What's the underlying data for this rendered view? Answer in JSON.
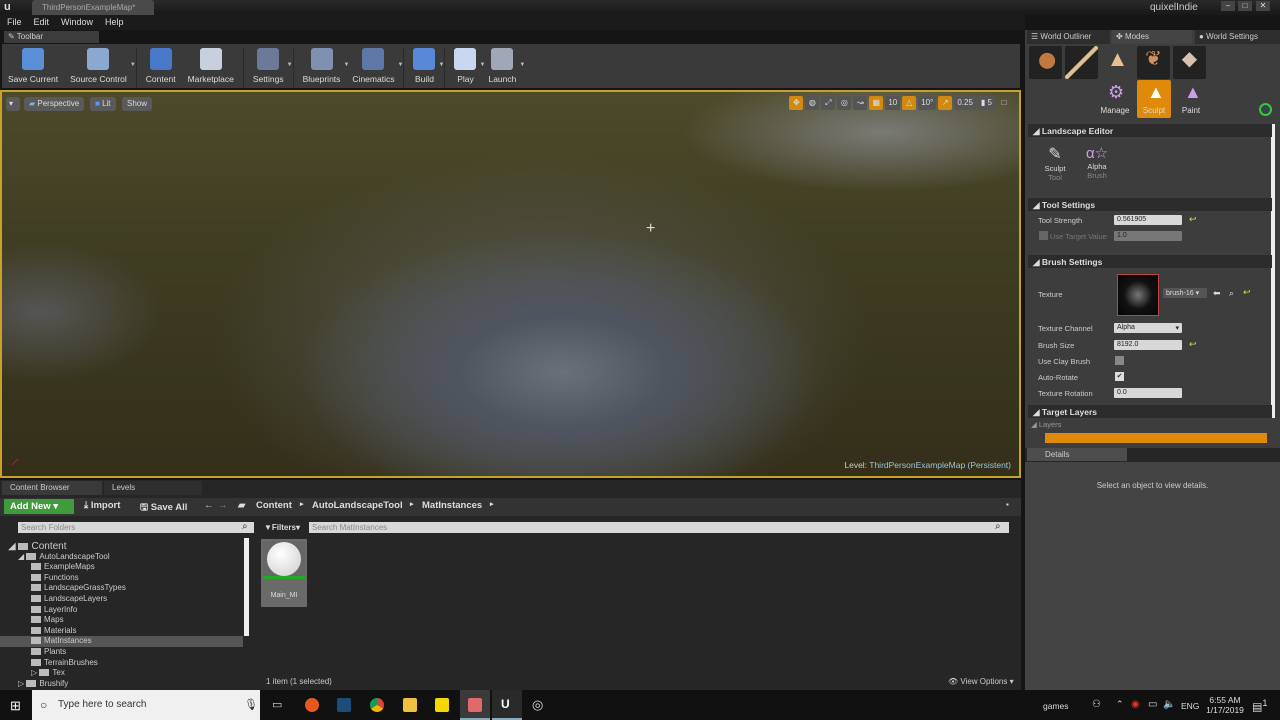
{
  "window": {
    "map_tab": "ThirdPersonExampleMap*",
    "user": "quixelIndie"
  },
  "menu": [
    "File",
    "Edit",
    "Window",
    "Help"
  ],
  "toolbar_tab": "Toolbar",
  "toolbar": [
    {
      "label": "Save Current",
      "color": "#5a8fd8",
      "dd": false
    },
    {
      "label": "Source Control",
      "color": "#8aa8d0",
      "dd": true
    },
    {
      "label": "Content",
      "color": "#4a78c8",
      "dd": false
    },
    {
      "label": "Marketplace",
      "color": "#c8d0e0",
      "dd": false
    },
    {
      "label": "Settings",
      "color": "#6a7a98",
      "dd": true
    },
    {
      "label": "Blueprints",
      "color": "#8090b0",
      "dd": true
    },
    {
      "label": "Cinematics",
      "color": "#6078a8",
      "dd": true
    },
    {
      "label": "Build",
      "color": "#5a88d8",
      "dd": true
    },
    {
      "label": "Play",
      "color": "#c8d8f0",
      "dd": true
    },
    {
      "label": "Launch",
      "color": "#a0a8b8",
      "dd": true
    }
  ],
  "viewport": {
    "perspective": "Perspective",
    "lit": "Lit",
    "show": "Show",
    "snap": {
      "grid": "10",
      "rotation": "10°",
      "scale": "0.25",
      "camera_speed": "5"
    },
    "level_label": "Level:",
    "level_name": "ThirdPersonExampleMap (Persistent)"
  },
  "right_tabs": [
    "World Outliner",
    "Modes",
    "World Settings"
  ],
  "modes": {
    "sub": [
      "Manage",
      "Sculpt",
      "Paint"
    ],
    "accent": "#e08a0b"
  },
  "landscape": {
    "section": "Landscape Editor",
    "tool": "Sculpt",
    "tool_sub": "Tool",
    "brush": "Alpha",
    "brush_sub": "Brush"
  },
  "tool_settings": {
    "section": "Tool Settings",
    "strength_label": "Tool Strength",
    "strength": "0.561905",
    "target_label": "Use Target Value",
    "target": "1.0"
  },
  "brush_settings": {
    "section": "Brush Settings",
    "texture_label": "Texture",
    "texture": "brush-16",
    "channel_label": "Texture Channel",
    "channel": "Alpha",
    "size_label": "Brush Size",
    "size": "8192.0",
    "clay_label": "Use Clay Brush",
    "autorotate_label": "Auto-Rotate",
    "rotation_label": "Texture Rotation",
    "rotation": "0.0"
  },
  "target_layers": {
    "section": "Target Layers",
    "layers": "Layers"
  },
  "details": {
    "tab": "Details",
    "empty": "Select an object to view details."
  },
  "content_browser": {
    "tab": "Content Browser",
    "levels_tab": "Levels",
    "add_new": "Add New",
    "import": "Import",
    "save_all": "Save All",
    "path": [
      "Content",
      "AutoLandscapeTool",
      "MatInstances"
    ],
    "search_folders": "Search Folders",
    "filters": "Filters",
    "search_assets": "Search MatInstances",
    "tree": [
      {
        "name": "Content",
        "depth": 0
      },
      {
        "name": "AutoLandscapeTool",
        "depth": 1
      },
      {
        "name": "ExampleMaps",
        "depth": 2
      },
      {
        "name": "Functions",
        "depth": 2
      },
      {
        "name": "LandscapeGrassTypes",
        "depth": 2
      },
      {
        "name": "LandscapeLayers",
        "depth": 2
      },
      {
        "name": "LayerInfo",
        "depth": 2
      },
      {
        "name": "Maps",
        "depth": 2
      },
      {
        "name": "Materials",
        "depth": 2
      },
      {
        "name": "MatInstances",
        "depth": 2,
        "selected": true
      },
      {
        "name": "Plants",
        "depth": 2
      },
      {
        "name": "TerrainBrushes",
        "depth": 2
      },
      {
        "name": "Tex",
        "depth": 2
      },
      {
        "name": "Brushify",
        "depth": 1
      }
    ],
    "asset": "Main_MI",
    "status": "1 item (1 selected)",
    "view_options": "View Options"
  },
  "taskbar": {
    "search": "Type here to search",
    "games": "games",
    "lang": "ENG",
    "time": "6:55 AM",
    "date": "1/17/2019",
    "notifications": "1"
  }
}
